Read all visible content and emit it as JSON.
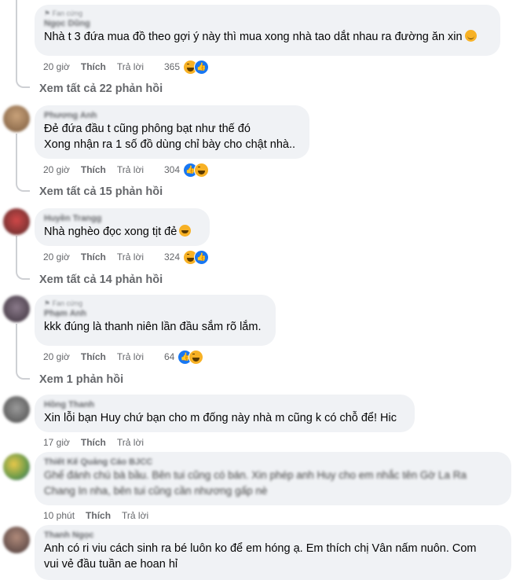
{
  "comments": [
    {
      "fan_label": "Fan cứng",
      "name": "Ngọc Dũng",
      "text": "Nhà t 3 đứa mua đồ theo gợi ý này thì mua xong nhà tao dắt nhau ra đường ăn xin",
      "time": "20 giờ",
      "like_label": "Thích",
      "reply_label": "Trả lời",
      "reactions": "365",
      "reaction_icons": [
        "haha-icon",
        "like-icon"
      ],
      "view_replies": "Xem tất cả 22 phản hồi"
    },
    {
      "name": "Phương Anh",
      "lines": [
        "Đẻ đứa đầu t cũng phông bạt như thế đó",
        "Xong nhận ra 1 số đồ dùng chỉ bày cho chật nhà.."
      ],
      "time": "20 giờ",
      "like_label": "Thích",
      "reply_label": "Trả lời",
      "reactions": "304",
      "reaction_icons": [
        "like-icon",
        "haha-icon"
      ],
      "view_replies": "Xem tất cả 15 phản hồi"
    },
    {
      "name": "Huyền Trangg",
      "text": "Nhà nghèo đọc xong tịt đẻ",
      "time": "20 giờ",
      "like_label": "Thích",
      "reply_label": "Trả lời",
      "reactions": "324",
      "reaction_icons": [
        "haha-icon",
        "like-icon"
      ],
      "view_replies": "Xem tất cả 14 phản hồi"
    },
    {
      "fan_label": "Fan cứng",
      "name": "Phạm Anh",
      "text": "kkk đúng là thanh niên lần đầu sắm rõ lắm.",
      "time": "20 giờ",
      "like_label": "Thích",
      "reply_label": "Trả lời",
      "reactions": "64",
      "reaction_icons": [
        "like-icon",
        "haha-icon"
      ],
      "view_replies": "Xem 1 phản hồi"
    },
    {
      "name": "Hồng Thanh",
      "text": "Xin lỗi bạn Huy chứ bạn cho m đống này nhà m cũng k có chỗ để! Hic",
      "time": "17 giờ",
      "like_label": "Thích",
      "reply_label": "Trả lời"
    },
    {
      "name": "Thiết Kế Quảng Cáo BJCC",
      "lines": [
        "Ghế đánh chú bà bầu. Bên tui cũng có bán. Xin phép anh Huy cho em nhắc tên Gờ La Ra",
        "Chang In nha, bên tui cũng cần nhương gấp nè"
      ],
      "time": "10 phút",
      "like_label": "Thích",
      "reply_label": "Trả lời"
    },
    {
      "name": "Thanh Ngọc",
      "lines": [
        "Anh có ri viu cách sinh ra bé luôn ko để em hóng ạ. Em thích chị Vân nấm nuôn. Com",
        "vui vẻ đầu tuần ae hoan hỉ"
      ]
    }
  ]
}
